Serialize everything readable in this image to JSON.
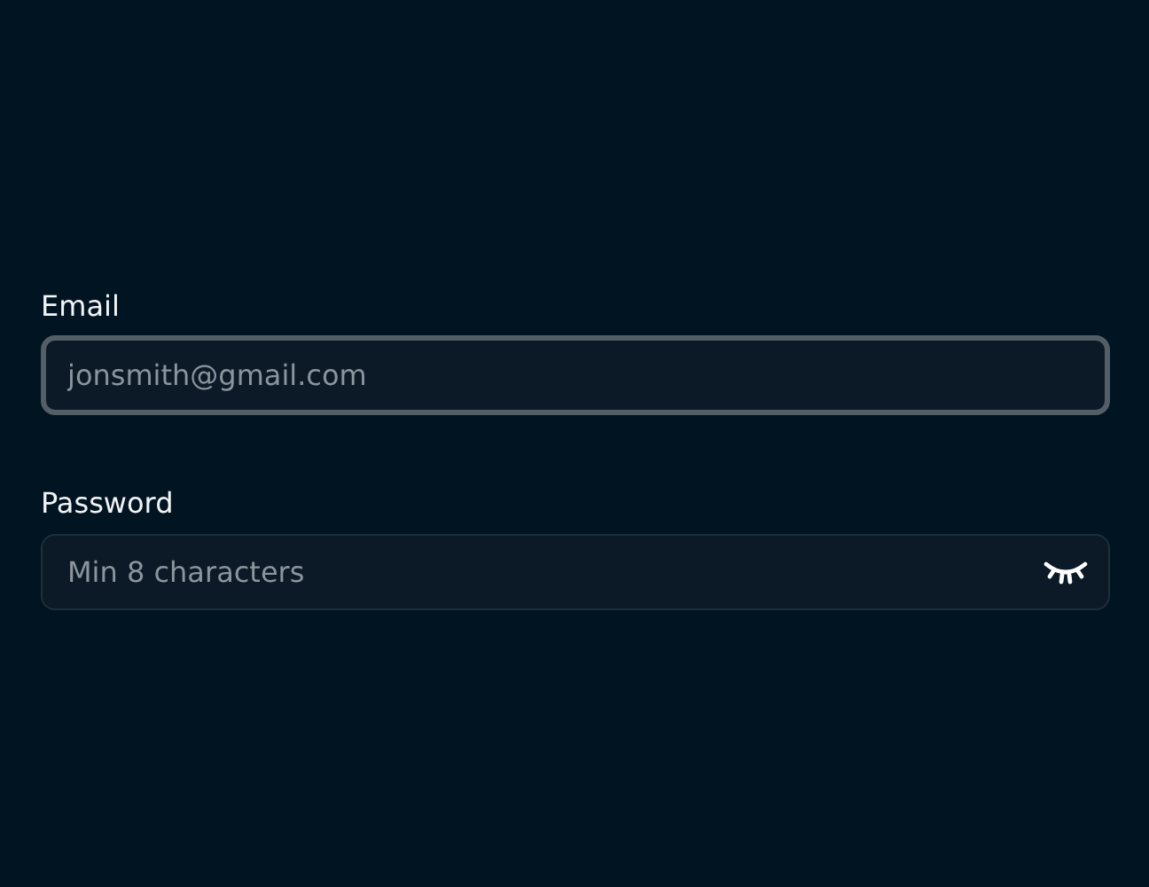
{
  "fields": [
    {
      "label": "Email",
      "placeholder": "jonsmith@gmail.com",
      "kind": "email",
      "focused": true
    },
    {
      "label": "Password",
      "placeholder": "Min 8 characters",
      "kind": "password",
      "focused": false
    }
  ]
}
